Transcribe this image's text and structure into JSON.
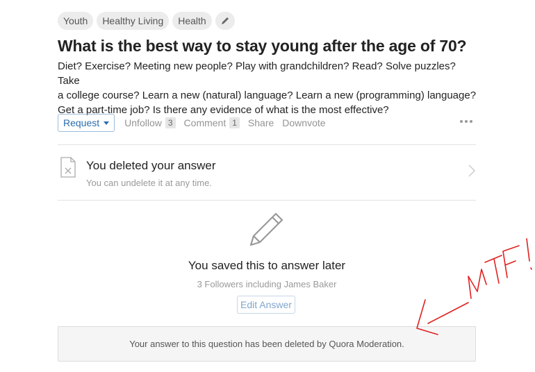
{
  "topics": [
    "Youth",
    "Healthy Living",
    "Health"
  ],
  "question": {
    "title": "What is the best way to stay young after the age of 70?",
    "details_lines": [
      "Diet? Exercise? Meeting new people?  Play with grandchildren? Read? Solve puzzles? Take",
      "a college course?  Learn a new (natural) language?  Learn a new (programming) language?",
      "Get a part-time job?  Is there any evidence of what is the most effective?"
    ]
  },
  "actions": {
    "request": "Request",
    "unfollow": "Unfollow",
    "unfollow_count": "3",
    "comment": "Comment",
    "comment_count": "1",
    "share": "Share",
    "downvote": "Downvote"
  },
  "deleted": {
    "title": "You deleted your answer",
    "subtitle": "You can undelete it at any time."
  },
  "saved": {
    "title": "You saved this to answer later",
    "subtitle": "3 Followers including James Baker",
    "edit_button": "Edit Answer"
  },
  "moderation_notice": "Your answer to this question has been deleted by Quora Moderation.",
  "annotation": {
    "text": "WTF!",
    "color": "#e02020"
  },
  "icons": [
    "pencil-icon",
    "document-icon",
    "chevron-right-icon",
    "more-icon",
    "caret-down-icon",
    "arrow-icon"
  ]
}
